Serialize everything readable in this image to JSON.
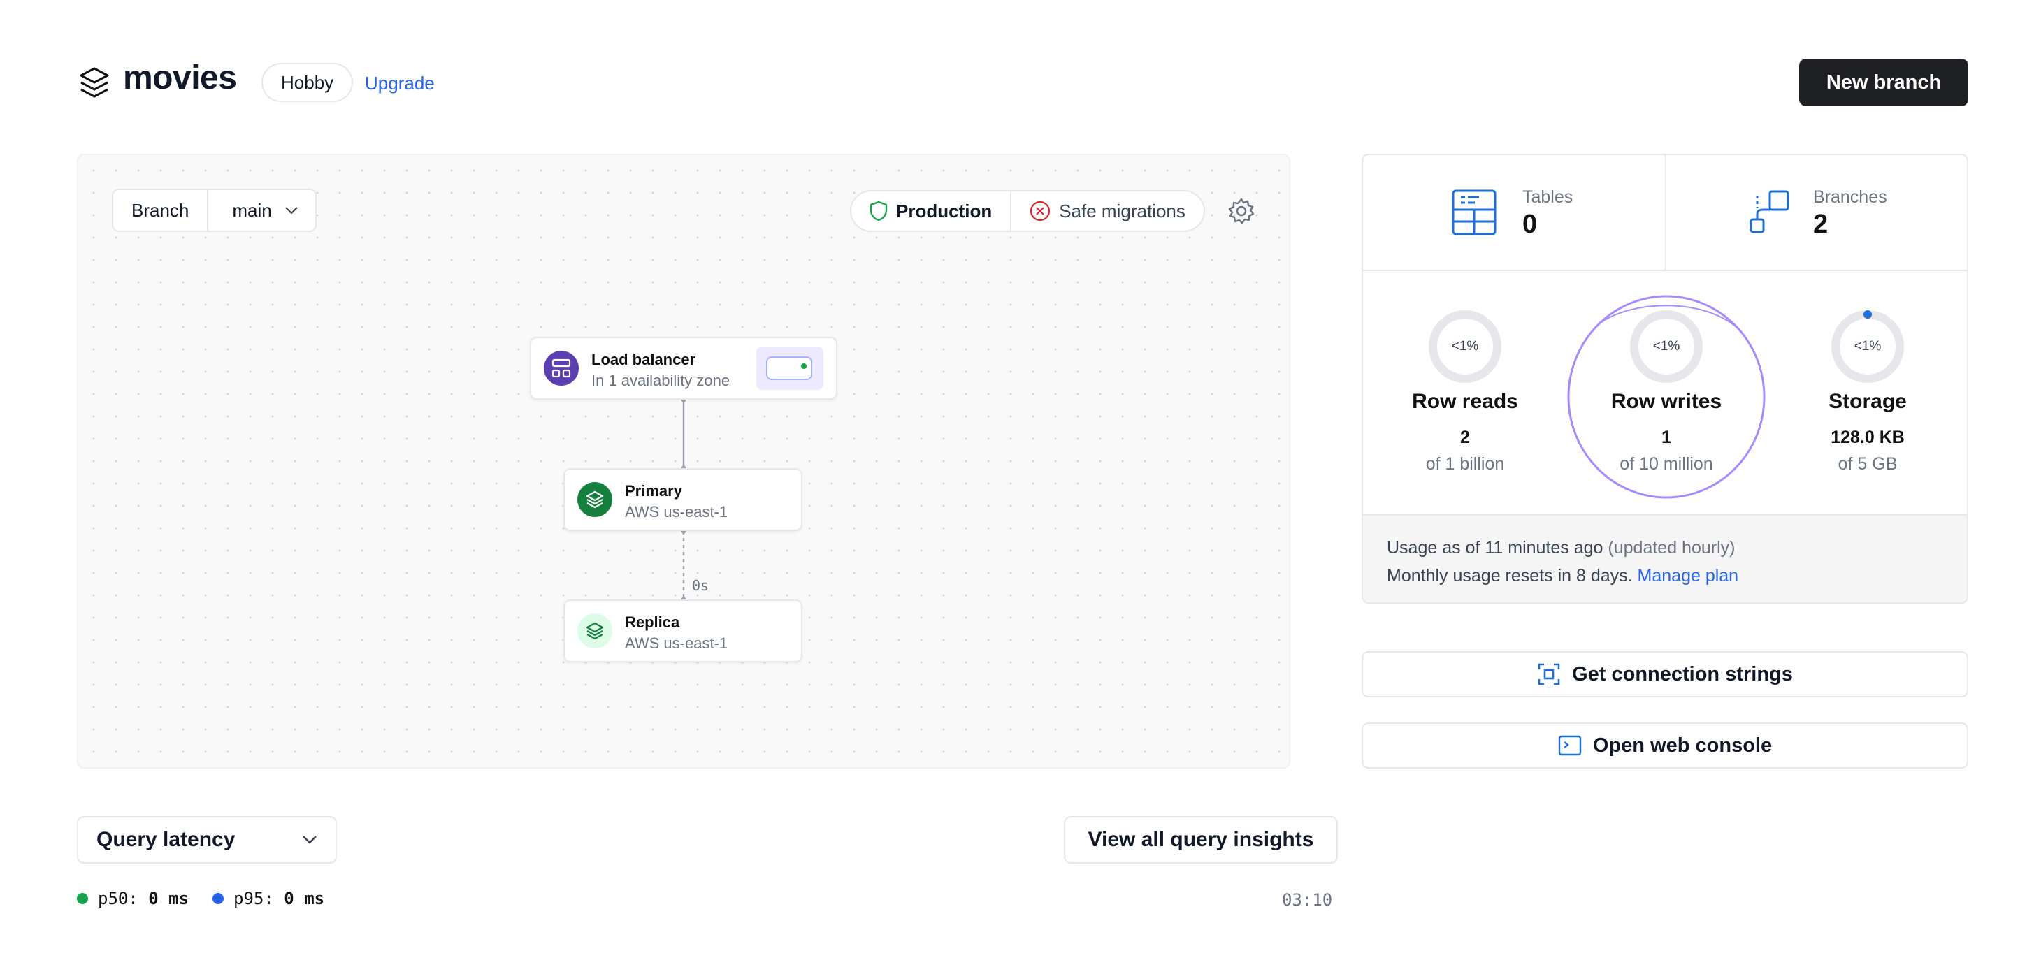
{
  "header": {
    "db_name": "movies",
    "plan": "Hobby",
    "upgrade": "Upgrade",
    "new_branch": "New branch"
  },
  "canvas": {
    "branch_label": "Branch",
    "branch_value": "main",
    "production": "Production",
    "safe_migrations": "Safe migrations",
    "nodes": {
      "load_balancer": {
        "title": "Load balancer",
        "subtitle": "In 1 availability zone"
      },
      "primary": {
        "title": "Primary",
        "subtitle": "AWS us-east-1"
      },
      "replica": {
        "title": "Replica",
        "subtitle": "AWS us-east-1"
      }
    },
    "replication_lag": "0s"
  },
  "stats": {
    "tables": {
      "label": "Tables",
      "value": "0"
    },
    "branches": {
      "label": "Branches",
      "value": "2"
    },
    "metrics": [
      {
        "pct": "<1%",
        "title": "Row reads",
        "value": "2",
        "of": "of 1 billion",
        "fraction": 0.0
      },
      {
        "pct": "<1%",
        "title": "Row writes",
        "value": "1",
        "of": "of 10 million",
        "fraction": 0.0
      },
      {
        "pct": "<1%",
        "title": "Storage",
        "value": "128.0 KB",
        "of": "of 5 GB",
        "fraction": 0.0
      }
    ],
    "usage_asof": "Usage as of 11 minutes ago",
    "usage_updated": "(updated hourly)",
    "usage_reset": "Monthly usage resets in 8 days.",
    "manage_plan": "Manage plan"
  },
  "actions": {
    "connection_strings": "Get connection strings",
    "web_console": "Open web console"
  },
  "latency": {
    "selector": "Query latency",
    "insights": "View all query insights",
    "p50_label": "p50:",
    "p50_value": "0 ms",
    "p95_label": "p95:",
    "p95_value": "0 ms",
    "time": "03:10"
  },
  "colors": {
    "accent_blue": "#2563eb",
    "p50": "#16a34a",
    "p95": "#2563eb",
    "annotation_circle": "#a78bfa",
    "primary_node": "#15803d",
    "lb_node": "#5b3fb0"
  }
}
